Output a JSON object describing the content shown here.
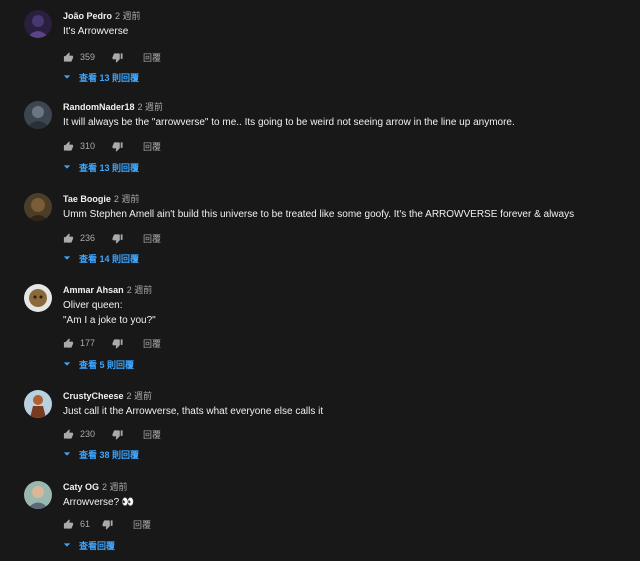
{
  "comments": [
    {
      "author": "João Pedro",
      "time": "2 週前",
      "text_lines": [
        "It's Arrowverse"
      ],
      "likes": "359",
      "reply_label": "回覆",
      "view_replies": "查看 13 則回覆",
      "avatar_color": "#3a2a55"
    },
    {
      "author": "RandomNader18",
      "time": "2 週前",
      "text_lines": [
        "It will always be the \"arrowverse\" to me.. Its going to be weird not seeing arrow in the line up anymore."
      ],
      "likes": "310",
      "reply_label": "回覆",
      "view_replies": "查看 13 則回覆",
      "avatar_color": "#4a5866"
    },
    {
      "author": "Tae Boogie",
      "time": "2 週前",
      "text_lines": [
        "Umm Stephen Amell ain't build this universe to be treated like some goofy. It's the ARROWVERSE forever & always"
      ],
      "likes": "236",
      "reply_label": "回覆",
      "view_replies": "查看 14 則回覆",
      "avatar_color": "#6b5a3a"
    },
    {
      "author": "Ammar Ahsan",
      "time": "2 週前",
      "text_lines": [
        "Oliver queen:",
        "\"Am I a joke to you?\""
      ],
      "likes": "177",
      "reply_label": "回覆",
      "view_replies": "查看 5 則回覆",
      "avatar_color": "#d9d9d9"
    },
    {
      "author": "CrustyCheese",
      "time": "2 週前",
      "text_lines": [
        "Just call it the Arrowverse, thats what everyone else calls it"
      ],
      "likes": "230",
      "reply_label": "回覆",
      "view_replies": "查看 38 則回覆",
      "avatar_color": "#a8c4d8"
    },
    {
      "author": "Caty OG",
      "time": "2 週前",
      "text_lines": [
        "Arrowverse? 👀"
      ],
      "likes": "61",
      "reply_label": "回覆",
      "view_replies": "查看回覆",
      "avatar_color": "#8fb0a0"
    }
  ],
  "colors": {
    "background": "#181818",
    "text": "#f1f1f1",
    "secondary": "#aaaaaa",
    "link": "#3ea6ff"
  }
}
